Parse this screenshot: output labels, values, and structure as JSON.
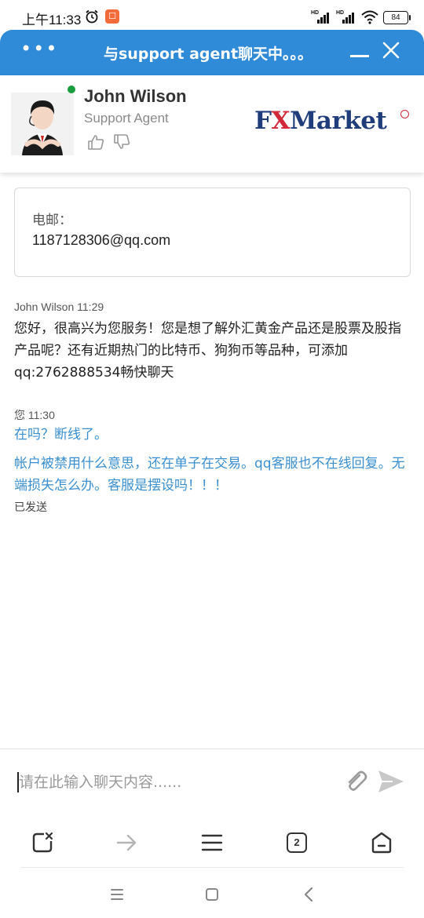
{
  "status_bar": {
    "time": "上午11:33",
    "battery": "84",
    "signal1_label": "HD",
    "signal2_label": "HD"
  },
  "header": {
    "title": "与support agent聊天中。。。",
    "menu_icon": "more-dots-icon",
    "minimize_icon": "minimize-icon",
    "close_icon": "close-icon",
    "color": "#2f8ad8"
  },
  "agent": {
    "name": "John Wilson",
    "role": "Support Agent",
    "status_color": "#1a9d3f",
    "logo_text_a": "F",
    "logo_text_x": "X",
    "logo_text_b": "Market"
  },
  "email_card": {
    "label": "电邮：",
    "value": "1187128306@qq.com"
  },
  "messages": [
    {
      "sender": "John Wilson",
      "time": "11:29",
      "meta": "John Wilson 11:29",
      "text": "您好，很高兴为您服务！您是想了解外汇黄金产品还是股票及股指产品呢？还有近期热门的比特币、狗狗币等品种，可添加qq:2762888534畅快聊天"
    },
    {
      "sender": "您",
      "time": "11:30",
      "meta": "您 11:30",
      "texts": [
        "在吗？断线了。",
        "帐户被禁用什么意思，还在单子在交易。qq客服也不在线回复。无端损失怎么办。客服是摆设吗！！！"
      ],
      "status": "已发送"
    }
  ],
  "composer": {
    "placeholder": "请在此输入聊天内容......",
    "value": ""
  },
  "browser_toolbar": {
    "tab_count": "2"
  },
  "colors": {
    "user_message": "#3a8fd0",
    "accent": "#2f8ad8"
  }
}
